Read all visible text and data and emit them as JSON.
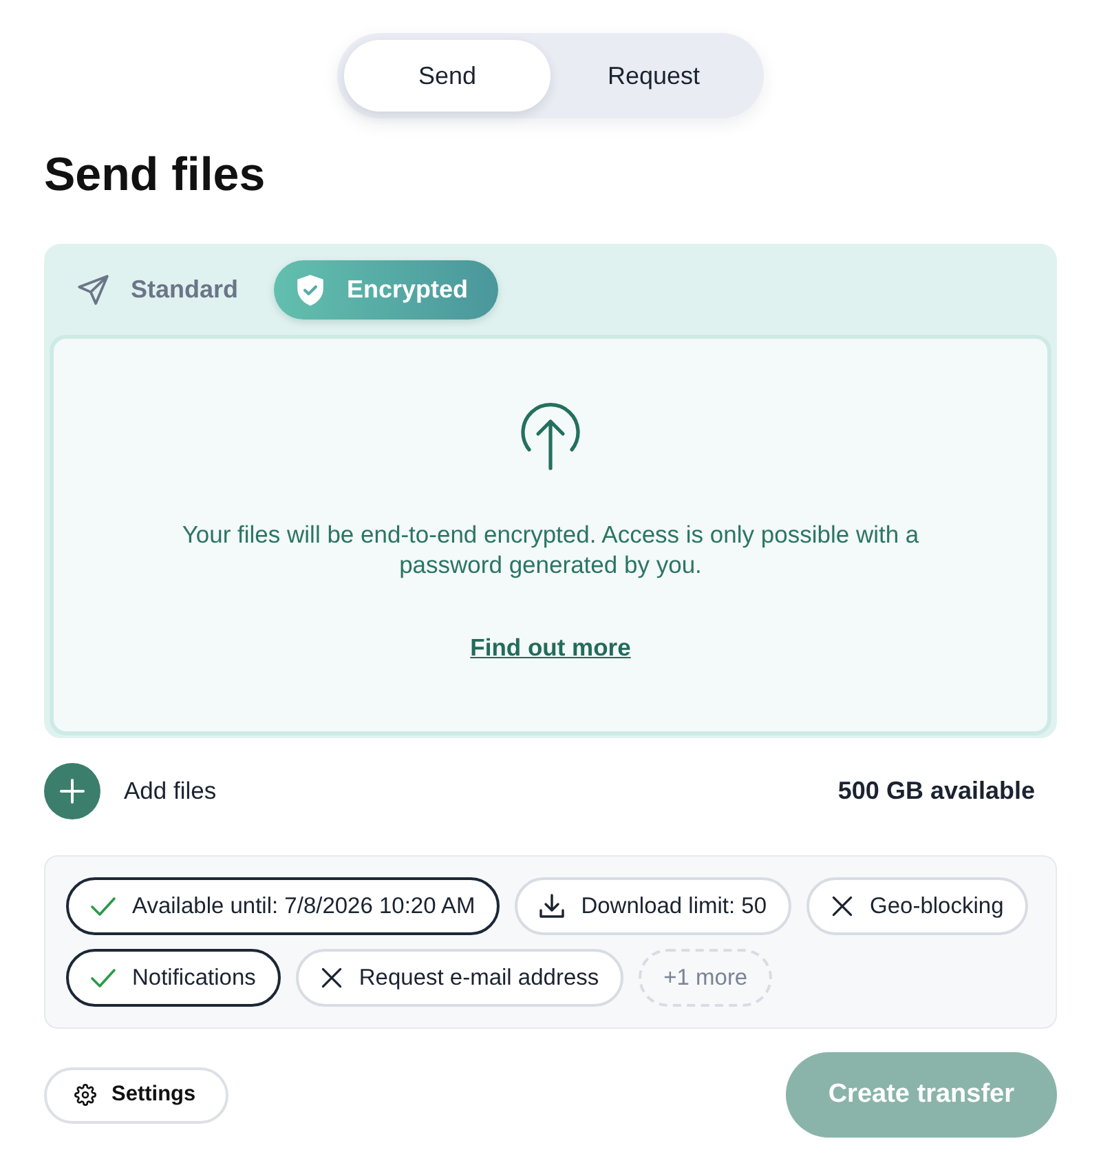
{
  "mode_switch": [
    {
      "label": "Send",
      "selected": true
    },
    {
      "label": "Request",
      "selected": false
    }
  ],
  "heading": "Send files",
  "transfer_types": [
    {
      "kind": "standard",
      "label": "Standard",
      "selected": false
    },
    {
      "kind": "encrypted",
      "label": "Encrypted",
      "selected": true
    }
  ],
  "drop_zone": {
    "text": "Your files will be end-to-end encrypted. Access is only possible with a password generated by you.",
    "link": "Find out more"
  },
  "add_files": "Add files",
  "storage": "500 GB available",
  "options": [
    {
      "kind": "toggle",
      "label": "Available until: 7/8/2026 10:20 AM",
      "on": true
    },
    {
      "kind": "limit",
      "label": "Download limit: 50",
      "on": false
    },
    {
      "kind": "toggle",
      "label": "Geo-blocking",
      "on": false
    },
    {
      "kind": "toggle",
      "label": "Notifications",
      "on": true
    },
    {
      "kind": "toggle",
      "label": "Request e-mail address",
      "on": false
    },
    {
      "kind": "more",
      "label": "+1 more",
      "on": false
    }
  ],
  "settings_button": "Settings",
  "create_button": {
    "label": "Create transfer",
    "disabled": true
  }
}
